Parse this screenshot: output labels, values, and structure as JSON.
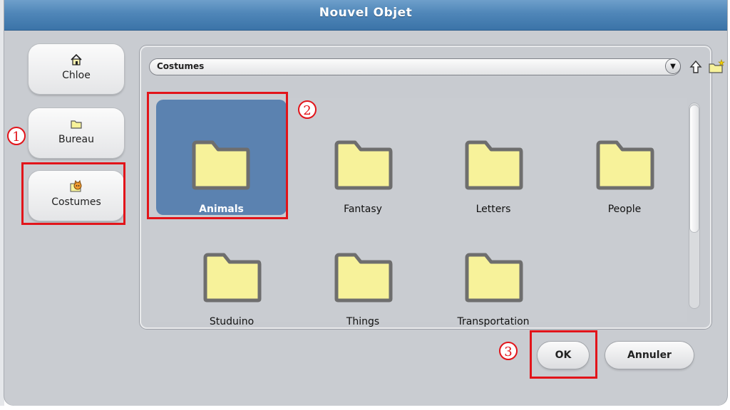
{
  "dialog": {
    "title": "Nouvel Objet"
  },
  "sidebar": {
    "items": [
      {
        "label": "Chloe",
        "icon": "home-icon"
      },
      {
        "label": "Bureau",
        "icon": "folder-icon"
      },
      {
        "label": "Costumes",
        "icon": "cat-costume-icon"
      }
    ]
  },
  "browser": {
    "path": "Costumes",
    "folders": [
      {
        "label": "Animals",
        "selected": true
      },
      {
        "label": "Fantasy"
      },
      {
        "label": "Letters"
      },
      {
        "label": "People"
      },
      {
        "label": "Studuino"
      },
      {
        "label": "Things"
      },
      {
        "label": "Transportation"
      }
    ]
  },
  "buttons": {
    "ok": "OK",
    "cancel": "Annuler"
  },
  "annotations": {
    "m1": "1",
    "m2": "2",
    "m3": "3"
  },
  "colors": {
    "title_bar": "#4f86b8",
    "selection": "#5b82b0",
    "folder_fill": "#f7f29a",
    "folder_stroke": "#6e6e6e",
    "highlight_red": "#e2141a"
  }
}
